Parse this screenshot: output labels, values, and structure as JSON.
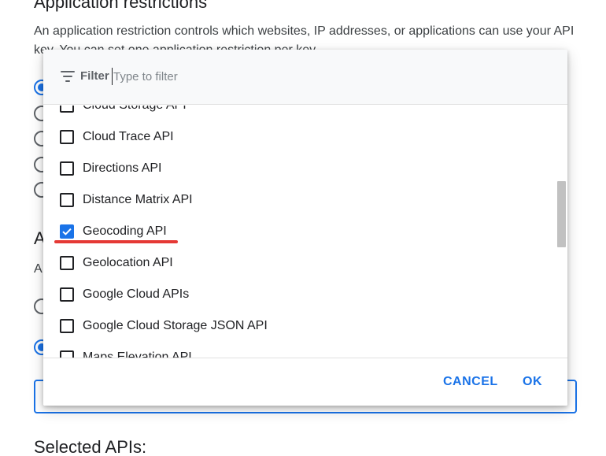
{
  "background": {
    "heading": "Application restrictions",
    "description": "An application restriction controls which websites, IP addresses, or applications can use your API key. You can set one application restriction per key.",
    "radios_top": [
      true,
      false,
      false,
      false,
      false
    ],
    "subheading": "A",
    "subtext": "A",
    "radios_bottom": [
      false,
      true
    ],
    "selected_apis_heading": "Selected APIs:"
  },
  "filter": {
    "label": "Filter",
    "placeholder": "Type to filter",
    "icon": "filter-list-icon"
  },
  "options": [
    {
      "label": "Cloud Storage API",
      "checked": false
    },
    {
      "label": "Cloud Trace API",
      "checked": false
    },
    {
      "label": "Directions API",
      "checked": false
    },
    {
      "label": "Distance Matrix API",
      "checked": false
    },
    {
      "label": "Geocoding API",
      "checked": true,
      "highlighted": true
    },
    {
      "label": "Geolocation API",
      "checked": false
    },
    {
      "label": "Google Cloud APIs",
      "checked": false
    },
    {
      "label": "Google Cloud Storage JSON API",
      "checked": false
    },
    {
      "label": "Maps Elevation API",
      "checked": false
    }
  ],
  "actions": {
    "cancel_label": "CANCEL",
    "ok_label": "OK"
  },
  "colors": {
    "accent": "#1a73e8",
    "annotation": "#e53935"
  }
}
